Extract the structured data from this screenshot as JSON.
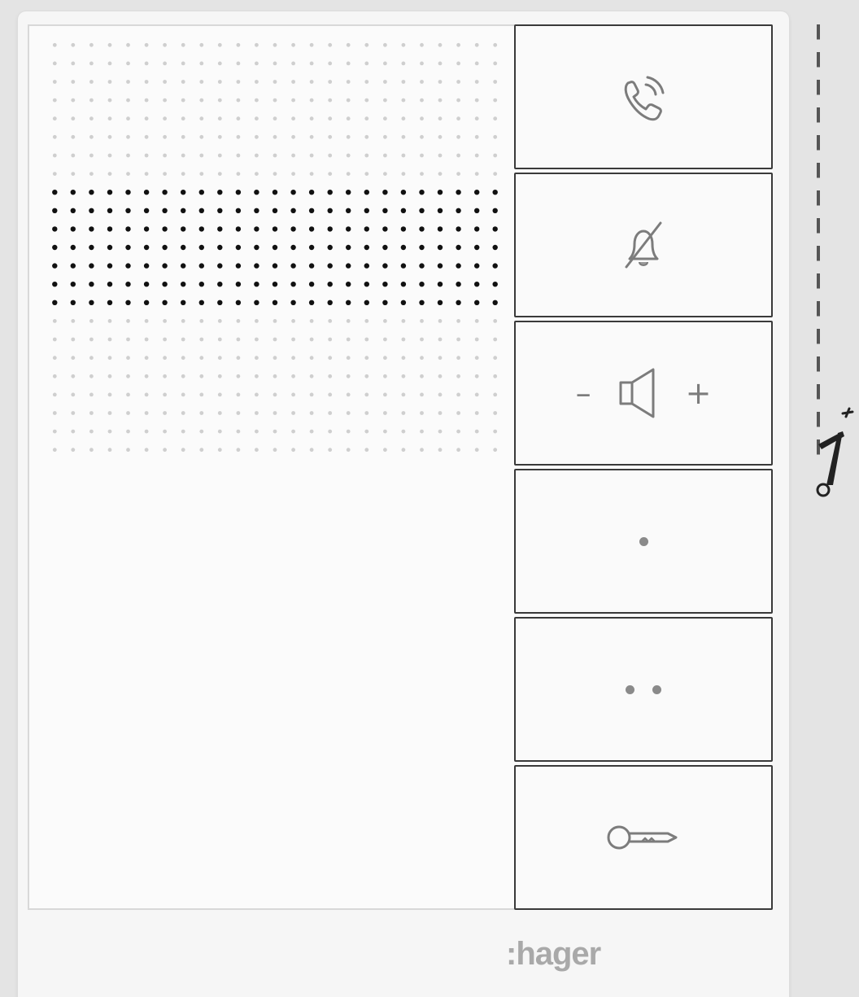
{
  "device": {
    "brand": ":hager"
  },
  "buttons": [
    {
      "name": "call-button",
      "icon": "phone-call-icon"
    },
    {
      "name": "mute-bell-button",
      "icon": "bell-off-icon"
    },
    {
      "name": "volume-button",
      "icon": "speaker-icon",
      "minus": "–",
      "plus": "+"
    },
    {
      "name": "aux-1-button",
      "icon": "single-dot-icon"
    },
    {
      "name": "aux-2-button",
      "icon": "double-dot-icon"
    },
    {
      "name": "door-open-button",
      "icon": "key-icon"
    }
  ],
  "colors": {
    "background": "#e4e4e4",
    "device": "#f6f6f6",
    "icon": "#7c7c7c",
    "brand": "#a9a9a9",
    "speaker_dot_active": "#111111",
    "speaker_dot_inactive": "#cfcfcf"
  }
}
